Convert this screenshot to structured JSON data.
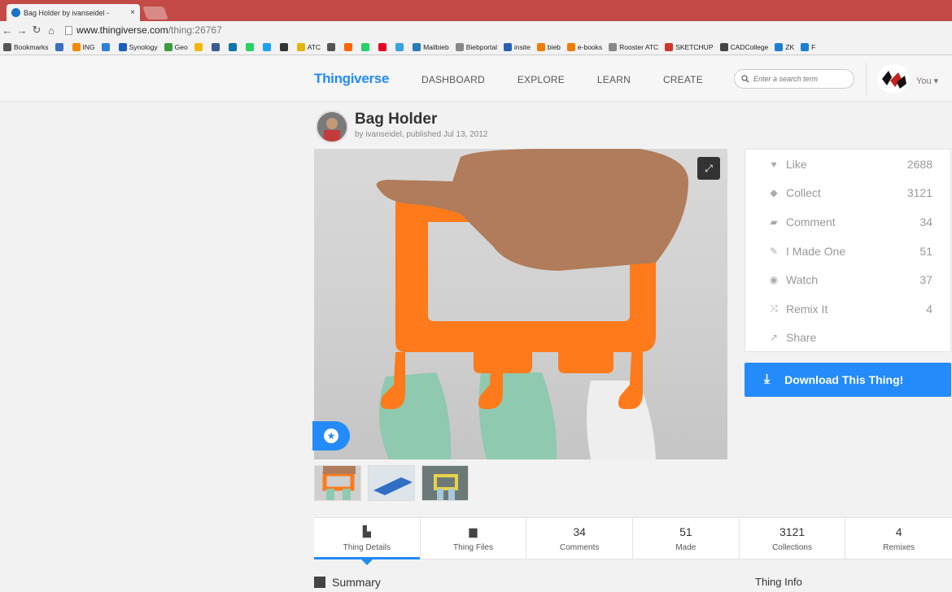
{
  "browser": {
    "tab_title": "Bag Holder by ivanseidel -",
    "tab_close": "×",
    "url_host": "www.thingiverse.com",
    "url_path": "/thing:26767",
    "bookmarks": [
      {
        "label": "Bookmarks",
        "color": "#555555"
      },
      {
        "label": "",
        "color": "#3a6fc2"
      },
      {
        "label": "ING",
        "color": "#f08a00"
      },
      {
        "label": "",
        "color": "#2f7fd8"
      },
      {
        "label": "Synology",
        "color": "#1c5fbf"
      },
      {
        "label": "Geo",
        "color": "#3e9b3e"
      },
      {
        "label": "",
        "color": "#f2b705"
      },
      {
        "label": "",
        "color": "#3b5998"
      },
      {
        "label": "",
        "color": "#0e76a8"
      },
      {
        "label": "",
        "color": "#25d366"
      },
      {
        "label": "",
        "color": "#1da1f2"
      },
      {
        "label": "",
        "color": "#333333"
      },
      {
        "label": "ATC",
        "color": "#e3b400"
      },
      {
        "label": "",
        "color": "#555555"
      },
      {
        "label": "",
        "color": "#ff6600"
      },
      {
        "label": "",
        "color": "#25d366"
      },
      {
        "label": "",
        "color": "#e60023"
      },
      {
        "label": "",
        "color": "#3aa3e3"
      },
      {
        "label": "Mailbieb",
        "color": "#2a7ab8"
      },
      {
        "label": "Biebportal",
        "color": "#888888"
      },
      {
        "label": "insite",
        "color": "#2b5fb5"
      },
      {
        "label": "bieb",
        "color": "#f07c00"
      },
      {
        "label": "e-books",
        "color": "#f07c00"
      },
      {
        "label": "Rooster ATC",
        "color": "#888888"
      },
      {
        "label": "SKETCHUP",
        "color": "#d0352b"
      },
      {
        "label": "CADCollege",
        "color": "#444444"
      },
      {
        "label": "ZK",
        "color": "#1c7fd1"
      },
      {
        "label": "F",
        "color": "#1c7fd1"
      }
    ]
  },
  "header": {
    "logo": "Thingiverse",
    "nav": [
      "DASHBOARD",
      "EXPLORE",
      "LEARN",
      "CREATE"
    ],
    "search_placeholder": "Enter a search term",
    "user_label": "You ▾"
  },
  "thing": {
    "title": "Bag Holder",
    "byline": "by ivanseidel, published Jul 13, 2012"
  },
  "actions": [
    {
      "icon": "heart-icon",
      "glyph": "♥",
      "label": "Like",
      "count": "2688"
    },
    {
      "icon": "collect-icon",
      "glyph": "◆",
      "label": "Collect",
      "count": "3121"
    },
    {
      "icon": "comment-icon",
      "glyph": "▰",
      "label": "Comment",
      "count": "34"
    },
    {
      "icon": "made-icon",
      "glyph": "✎",
      "label": "I Made One",
      "count": "51"
    },
    {
      "icon": "eye-icon",
      "glyph": "◉",
      "label": "Watch",
      "count": "37"
    },
    {
      "icon": "remix-icon",
      "glyph": "⤨",
      "label": "Remix It",
      "count": "4"
    },
    {
      "icon": "share-icon",
      "glyph": "↗",
      "label": "Share",
      "count": ""
    }
  ],
  "download": {
    "label": "Download This Thing!",
    "glyph": "⤓"
  },
  "stats": [
    {
      "top": "",
      "icon": "book-icon",
      "label": "Thing Details",
      "active": true
    },
    {
      "top": "",
      "icon": "folder-icon",
      "label": "Thing Files",
      "active": false
    },
    {
      "top": "34",
      "label": "Comments"
    },
    {
      "top": "51",
      "label": "Made"
    },
    {
      "top": "3121",
      "label": "Collections"
    },
    {
      "top": "4",
      "label": "Remixes"
    }
  ],
  "sections": {
    "summary": "Summary",
    "thing_info": "Thing Info"
  },
  "colors": {
    "accent": "#248bfb",
    "orange_print": "#ff7a1a",
    "tabstrip": "#c34a46"
  }
}
